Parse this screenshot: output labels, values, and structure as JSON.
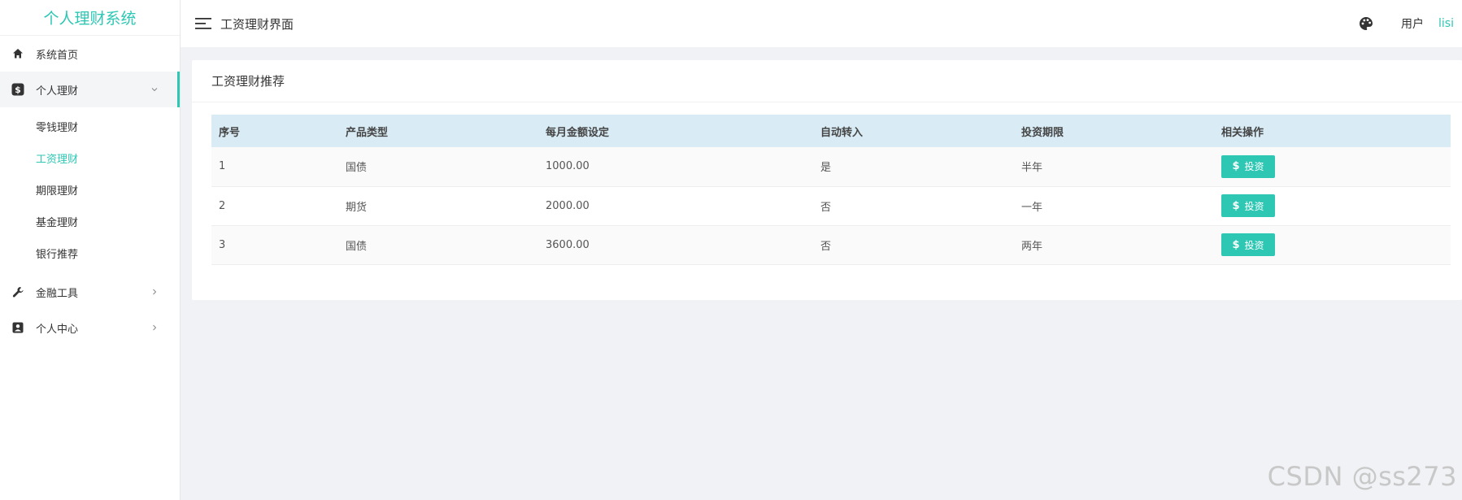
{
  "brand": "个人理财系统",
  "header": {
    "title": "工资理财界面",
    "user_label": "用户",
    "user_name": "lisi"
  },
  "sidebar": {
    "items": [
      {
        "label": "系统首页",
        "icon": "home-icon"
      },
      {
        "label": "个人理财",
        "icon": "dollar-icon",
        "open": true,
        "children": [
          "零钱理财",
          "工资理财",
          "期限理财",
          "基金理财",
          "银行推荐"
        ],
        "active_child": "工资理财"
      },
      {
        "label": "金融工具",
        "icon": "wrench-icon"
      },
      {
        "label": "个人中心",
        "icon": "user-card-icon"
      }
    ]
  },
  "card": {
    "title": "工资理财推荐",
    "columns": [
      "序号",
      "产品类型",
      "每月金额设定",
      "自动转入",
      "投资期限",
      "相关操作"
    ],
    "rows": [
      [
        "1",
        "国债",
        "1000.00",
        "是",
        "半年"
      ],
      [
        "2",
        "期货",
        "2000.00",
        "否",
        "一年"
      ],
      [
        "3",
        "国债",
        "3600.00",
        "否",
        "两年"
      ]
    ],
    "action_label": "投资",
    "action_symbol": "$"
  },
  "watermark": "CSDN @ss273",
  "colors": {
    "accent": "#2ec7b4",
    "table_header_bg": "#d9ecf5"
  }
}
